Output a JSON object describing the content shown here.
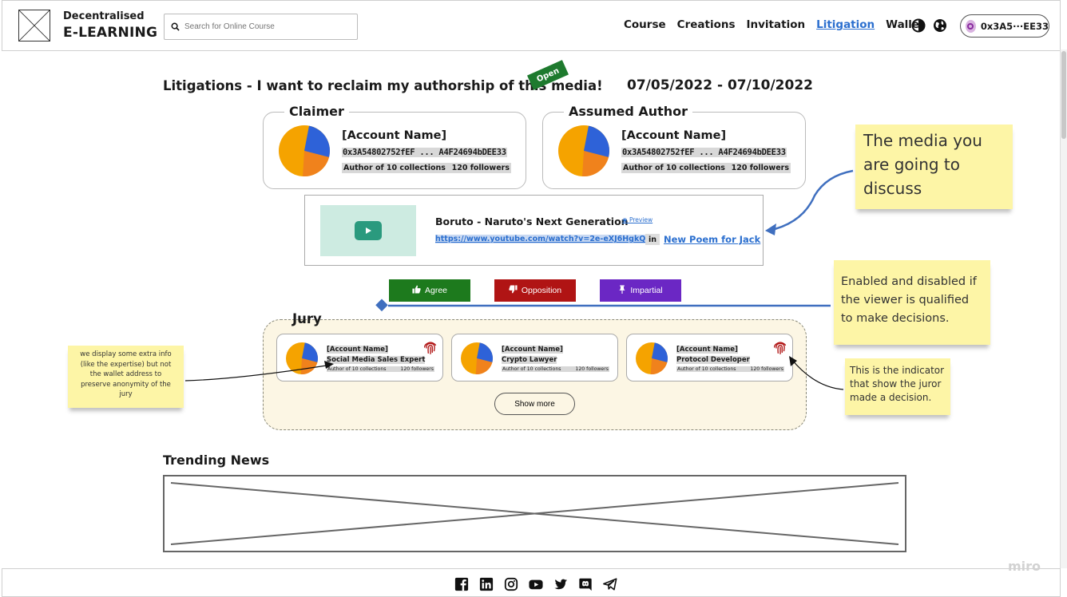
{
  "header": {
    "brand_top": "Decentralised",
    "brand_bottom": "E-LEARNING",
    "search_placeholder": "Search for Online Course",
    "nav": [
      "Course",
      "Creations",
      "Invitation",
      "Litigation",
      "Wallet"
    ],
    "active_nav": "Litigation",
    "wallet_address": "0x3A5···EE33"
  },
  "litigation": {
    "title": "Litigations - I want to reclaim my authorship of this media!",
    "status_badge": "Open",
    "date_range": "07/05/2022 - 07/10/2022"
  },
  "claimer": {
    "legend": "Claimer",
    "name": "[Account Name]",
    "address": "0x3A54802752fEF ... A4F24694bDEE33",
    "author_of": "Author of 10 collections",
    "followers": "120 followers"
  },
  "assumed_author": {
    "legend": "Assumed Author",
    "name": "[Account Name]",
    "address": "0x3A54802752fEF ... A4F24694bDEE33",
    "author_of": "Author of 10 collections",
    "followers": "120 followers"
  },
  "media": {
    "title": "Boruto - Naruto's Next Generation",
    "preview_label": "Preview",
    "url": "https://www.youtube.com/watch?v=2e-eXJ6HgkQ",
    "in_label": "in",
    "collection": "New Poem for Jack"
  },
  "decision_buttons": {
    "agree": "Agree",
    "opposition": "Opposition",
    "impartial": "Impartial"
  },
  "jury": {
    "label": "Jury",
    "show_more": "Show more",
    "jurors": [
      {
        "name": "[Account Name]",
        "expertise": "Social Media Sales Expert",
        "author_of": "Author of 10 collections",
        "followers": "120 followers",
        "decided": true
      },
      {
        "name": "[Account Name]",
        "expertise": "Crypto Lawyer",
        "author_of": "Author of 10 collections",
        "followers": "120 followers",
        "decided": false
      },
      {
        "name": "[Account Name]",
        "expertise": "Protocol Developer",
        "author_of": "Author of 10 collections",
        "followers": "120 followers",
        "decided": true
      }
    ]
  },
  "trending": {
    "title": "Trending News"
  },
  "annotations": {
    "media_note": "The media you are going to discuss",
    "enable_note": "Enabled and disabled if the viewer is qualified to make decisions.",
    "extra_info_note": "we display some extra info (like the expertise) but not the wallet address to preserve anonymity of the jury",
    "indicator_note": "This is the indicator that show the juror made a decision."
  },
  "footer": {
    "social_icons": [
      "facebook-icon",
      "linkedin-icon",
      "instagram-icon",
      "youtube-icon",
      "twitter-icon",
      "discord-icon",
      "telegram-icon"
    ],
    "watermark": "miro"
  },
  "colors": {
    "link": "#2b6fcf",
    "agree": "#1d7a1d",
    "opposition": "#b01414",
    "impartial": "#6b27c4",
    "open_badge": "#1e7a2e",
    "sticky": "#fdf5a6",
    "jury_bg": "#fcf6e4"
  }
}
